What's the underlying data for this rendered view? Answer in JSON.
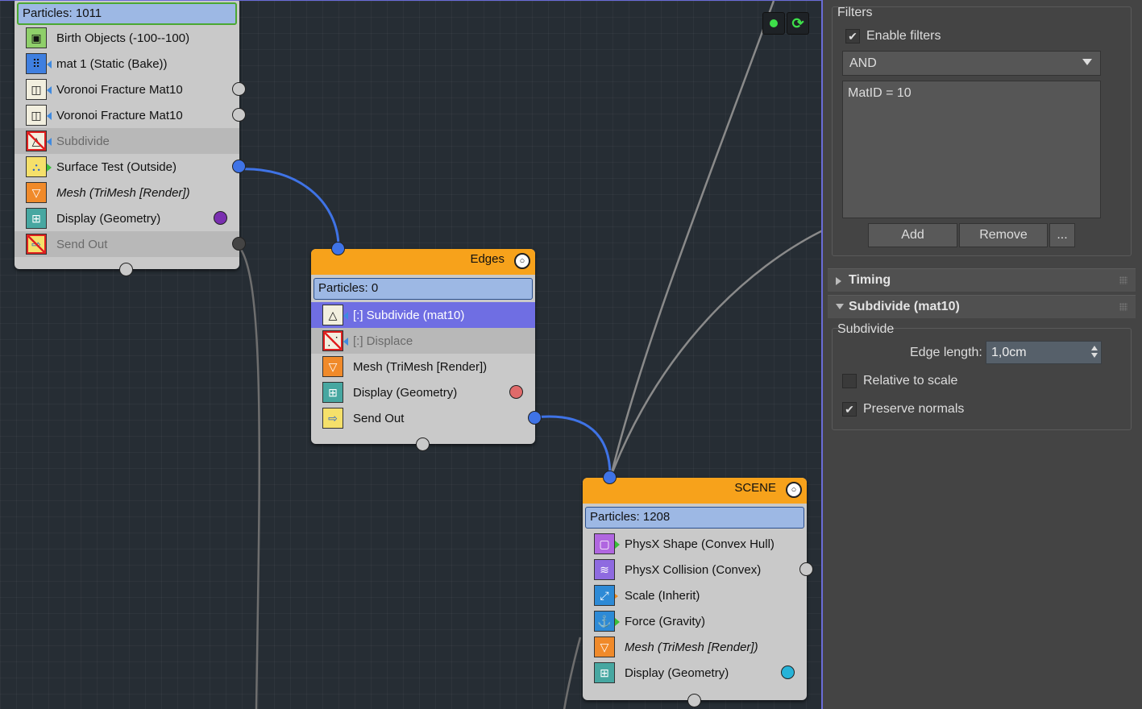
{
  "canvas": {
    "top_icons": [
      "green-dot-icon",
      "refresh-icon"
    ]
  },
  "node1": {
    "count": "Particles: 1011",
    "operators": [
      {
        "label": "Birth Objects (-100--100)",
        "icon": "birth-objects-icon",
        "state": "normal"
      },
      {
        "label": "mat 1 (Static (Bake))",
        "icon": "material-static-icon",
        "state": "normal"
      },
      {
        "label": "Voronoi Fracture Mat10",
        "icon": "voronoi-fracture-icon",
        "state": "normal"
      },
      {
        "label": "Voronoi Fracture Mat10",
        "icon": "voronoi-fracture-icon",
        "state": "normal"
      },
      {
        "label": "Subdivide",
        "icon": "subdivide-icon",
        "state": "disabled"
      },
      {
        "label": "Surface Test (Outside)",
        "icon": "surface-test-icon",
        "state": "normal"
      },
      {
        "label": "Mesh (TriMesh [Render])",
        "icon": "mesh-icon",
        "state": "normal"
      },
      {
        "label": "Display (Geometry)",
        "icon": "display-icon",
        "state": "normal"
      },
      {
        "label": "Send Out",
        "icon": "send-out-icon",
        "state": "disabled"
      }
    ]
  },
  "node2": {
    "name": "Edges",
    "count": "Particles: 0",
    "operators": [
      {
        "label": "[:] Subdivide (mat10)",
        "icon": "subdivide-icon",
        "state": "selected"
      },
      {
        "label": "[:] Displace",
        "icon": "displace-icon",
        "state": "disabled"
      },
      {
        "label": "Mesh (TriMesh [Render])",
        "icon": "mesh-icon",
        "state": "normal"
      },
      {
        "label": "Display (Geometry)",
        "icon": "display-icon",
        "state": "normal"
      },
      {
        "label": "Send Out",
        "icon": "send-out-icon",
        "state": "normal"
      }
    ]
  },
  "node3": {
    "name": "SCENE",
    "count": "Particles: 1208",
    "operators": [
      {
        "label": "PhysX Shape (Convex Hull)",
        "icon": "physx-shape-icon",
        "state": "normal"
      },
      {
        "label": "PhysX Collision (Convex)",
        "icon": "physx-collision-icon",
        "state": "normal"
      },
      {
        "label": "Scale (Inherit)",
        "icon": "scale-icon",
        "state": "normal"
      },
      {
        "label": "Force (Gravity)",
        "icon": "force-icon",
        "state": "normal"
      },
      {
        "label": "Mesh (TriMesh [Render])",
        "icon": "mesh-icon",
        "state": "normal"
      },
      {
        "label": "Display (Geometry)",
        "icon": "display-icon",
        "state": "normal"
      }
    ]
  },
  "panel": {
    "filters": {
      "title": "Filters",
      "enable_label": "Enable filters",
      "enable_checked": true,
      "mode": "AND",
      "expression": "MatID = 10",
      "add_label": "Add",
      "remove_label": "Remove",
      "more_label": "..."
    },
    "timing": {
      "title": "Timing"
    },
    "subdivide": {
      "title": "Subdivide (mat10)",
      "group_title": "Subdivide",
      "edge_length_label": "Edge length:",
      "edge_length_value": "1,0cm",
      "relative_label": "Relative to scale",
      "relative_checked": false,
      "preserve_label": "Preserve normals",
      "preserve_checked": true
    }
  },
  "colors": {
    "canvas_bg": "#262d34",
    "node_header": "#f7a21b",
    "selected_row": "#6f6ee3",
    "wire_blue": "#3f73e6",
    "wire_gray": "#7a7a7a",
    "panel_bg": "#444444"
  }
}
